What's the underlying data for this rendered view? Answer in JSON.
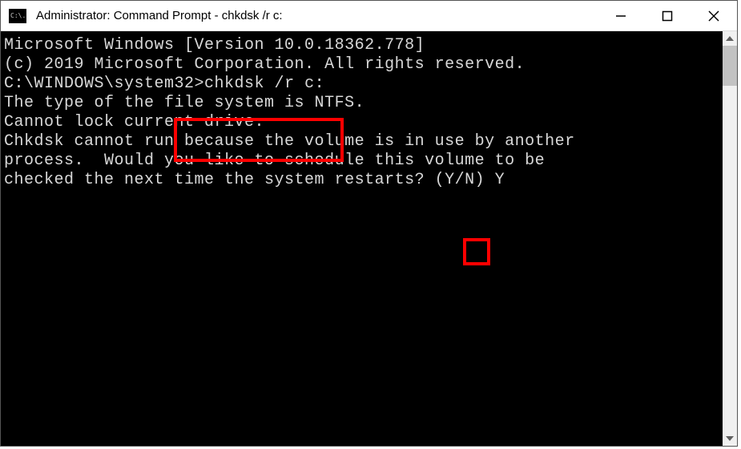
{
  "titlebar": {
    "icon_text": "C:\\.",
    "title": "Administrator: Command Prompt - chkdsk /r c:"
  },
  "terminal": {
    "line1": "Microsoft Windows [Version 10.0.18362.778]",
    "line2": "(c) 2019 Microsoft Corporation. All rights reserved.",
    "line3": "",
    "prompt": "C:\\WINDOWS\\system32>",
    "command": "chkdsk /r c:",
    "line5": "The type of the file system is NTFS.",
    "line6": "Cannot lock current drive.",
    "line7": "",
    "line8": "Chkdsk cannot run because the volume is in use by another",
    "line9": "process.  Would you like to schedule this volume to be",
    "line10_a": "checked the next time the system restarts? (Y/N) ",
    "line10_answer": "Y"
  }
}
